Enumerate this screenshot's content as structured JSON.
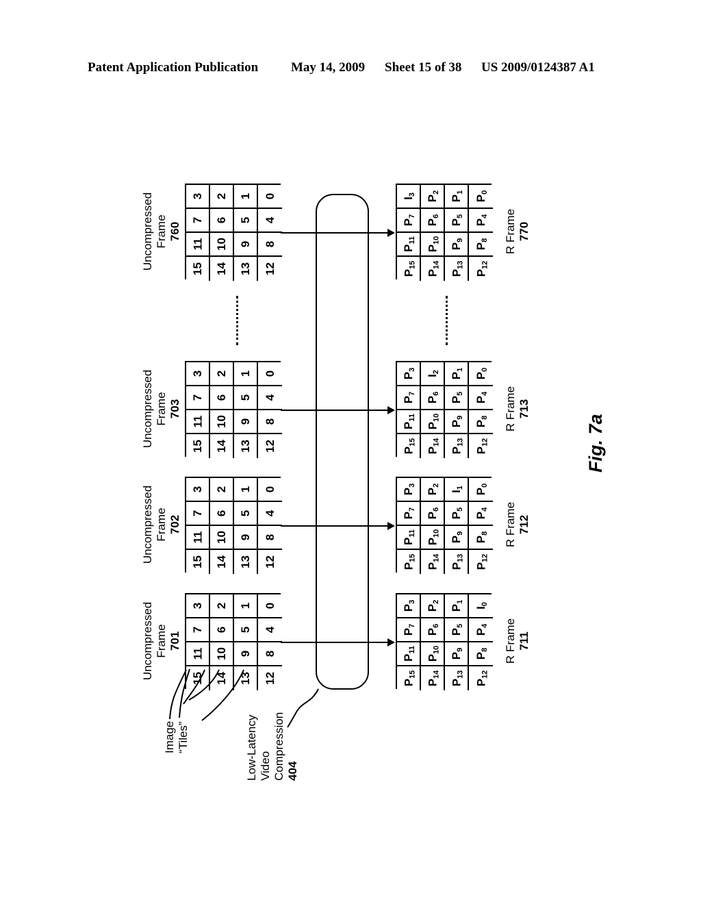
{
  "header": {
    "publication": "Patent Application Publication",
    "date": "May 14, 2009",
    "sheet": "Sheet 15 of 38",
    "patent_number": "US 2009/0124387 A1"
  },
  "figure": {
    "label": "Fig. 7a"
  },
  "annotations": {
    "image_tiles": {
      "line1": "Image",
      "line2": "“Tiles”"
    },
    "compression": {
      "line1": "Low-Latency",
      "line2": "Video",
      "line3": "Compression",
      "number": "404"
    }
  },
  "uncompressed_frames": [
    {
      "caption_line1": "Uncompressed",
      "caption_line2": "Frame",
      "number": "701",
      "cells": [
        [
          "0",
          "1",
          "2",
          "3"
        ],
        [
          "4",
          "5",
          "6",
          "7"
        ],
        [
          "8",
          "9",
          "10",
          "11"
        ],
        [
          "12",
          "13",
          "14",
          "15"
        ]
      ]
    },
    {
      "caption_line1": "Uncompressed",
      "caption_line2": "Frame",
      "number": "702",
      "cells": [
        [
          "0",
          "1",
          "2",
          "3"
        ],
        [
          "4",
          "5",
          "6",
          "7"
        ],
        [
          "8",
          "9",
          "10",
          "11"
        ],
        [
          "12",
          "13",
          "14",
          "15"
        ]
      ]
    },
    {
      "caption_line1": "Uncompressed",
      "caption_line2": "Frame",
      "number": "703",
      "cells": [
        [
          "0",
          "1",
          "2",
          "3"
        ],
        [
          "4",
          "5",
          "6",
          "7"
        ],
        [
          "8",
          "9",
          "10",
          "11"
        ],
        [
          "12",
          "13",
          "14",
          "15"
        ]
      ]
    },
    {
      "caption_line1": "Uncompressed",
      "caption_line2": "Frame",
      "number": "760",
      "cells": [
        [
          "0",
          "1",
          "2",
          "3"
        ],
        [
          "4",
          "5",
          "6",
          "7"
        ],
        [
          "8",
          "9",
          "10",
          "11"
        ],
        [
          "12",
          "13",
          "14",
          "15"
        ]
      ]
    }
  ],
  "r_frames": [
    {
      "caption_line1": "R Frame",
      "number": "711",
      "cells": [
        [
          {
            "base": "I",
            "sub": "0"
          },
          {
            "base": "P",
            "sub": "1"
          },
          {
            "base": "P",
            "sub": "2"
          },
          {
            "base": "P",
            "sub": "3"
          }
        ],
        [
          {
            "base": "P",
            "sub": "4"
          },
          {
            "base": "P",
            "sub": "5"
          },
          {
            "base": "P",
            "sub": "6"
          },
          {
            "base": "P",
            "sub": "7"
          }
        ],
        [
          {
            "base": "P",
            "sub": "8"
          },
          {
            "base": "P",
            "sub": "9"
          },
          {
            "base": "P",
            "sub": "10"
          },
          {
            "base": "P",
            "sub": "11"
          }
        ],
        [
          {
            "base": "P",
            "sub": "12"
          },
          {
            "base": "P",
            "sub": "13"
          },
          {
            "base": "P",
            "sub": "14"
          },
          {
            "base": "P",
            "sub": "15"
          }
        ]
      ]
    },
    {
      "caption_line1": "R Frame",
      "number": "712",
      "cells": [
        [
          {
            "base": "P",
            "sub": "0"
          },
          {
            "base": "I",
            "sub": "1"
          },
          {
            "base": "P",
            "sub": "2"
          },
          {
            "base": "P",
            "sub": "3"
          }
        ],
        [
          {
            "base": "P",
            "sub": "4"
          },
          {
            "base": "P",
            "sub": "5"
          },
          {
            "base": "P",
            "sub": "6"
          },
          {
            "base": "P",
            "sub": "7"
          }
        ],
        [
          {
            "base": "P",
            "sub": "8"
          },
          {
            "base": "P",
            "sub": "9"
          },
          {
            "base": "P",
            "sub": "10"
          },
          {
            "base": "P",
            "sub": "11"
          }
        ],
        [
          {
            "base": "P",
            "sub": "12"
          },
          {
            "base": "P",
            "sub": "13"
          },
          {
            "base": "P",
            "sub": "14"
          },
          {
            "base": "P",
            "sub": "15"
          }
        ]
      ]
    },
    {
      "caption_line1": "R Frame",
      "number": "713",
      "cells": [
        [
          {
            "base": "P",
            "sub": "0"
          },
          {
            "base": "P",
            "sub": "1"
          },
          {
            "base": "I",
            "sub": "2"
          },
          {
            "base": "P",
            "sub": "3"
          }
        ],
        [
          {
            "base": "P",
            "sub": "4"
          },
          {
            "base": "P",
            "sub": "5"
          },
          {
            "base": "P",
            "sub": "6"
          },
          {
            "base": "P",
            "sub": "7"
          }
        ],
        [
          {
            "base": "P",
            "sub": "8"
          },
          {
            "base": "P",
            "sub": "9"
          },
          {
            "base": "P",
            "sub": "10"
          },
          {
            "base": "P",
            "sub": "11"
          }
        ],
        [
          {
            "base": "P",
            "sub": "12"
          },
          {
            "base": "P",
            "sub": "13"
          },
          {
            "base": "P",
            "sub": "14"
          },
          {
            "base": "P",
            "sub": "15"
          }
        ]
      ]
    },
    {
      "caption_line1": "R Frame",
      "number": "770",
      "cells": [
        [
          {
            "base": "P",
            "sub": "0"
          },
          {
            "base": "P",
            "sub": "1"
          },
          {
            "base": "P",
            "sub": "2"
          },
          {
            "base": "I",
            "sub": "3"
          }
        ],
        [
          {
            "base": "P",
            "sub": "4"
          },
          {
            "base": "P",
            "sub": "5"
          },
          {
            "base": "P",
            "sub": "6"
          },
          {
            "base": "P",
            "sub": "7"
          }
        ],
        [
          {
            "base": "P",
            "sub": "8"
          },
          {
            "base": "P",
            "sub": "9"
          },
          {
            "base": "P",
            "sub": "10"
          },
          {
            "base": "P",
            "sub": "11"
          }
        ],
        [
          {
            "base": "P",
            "sub": "12"
          },
          {
            "base": "P",
            "sub": "13"
          },
          {
            "base": "P",
            "sub": "14"
          },
          {
            "base": "P",
            "sub": "15"
          }
        ]
      ]
    }
  ]
}
